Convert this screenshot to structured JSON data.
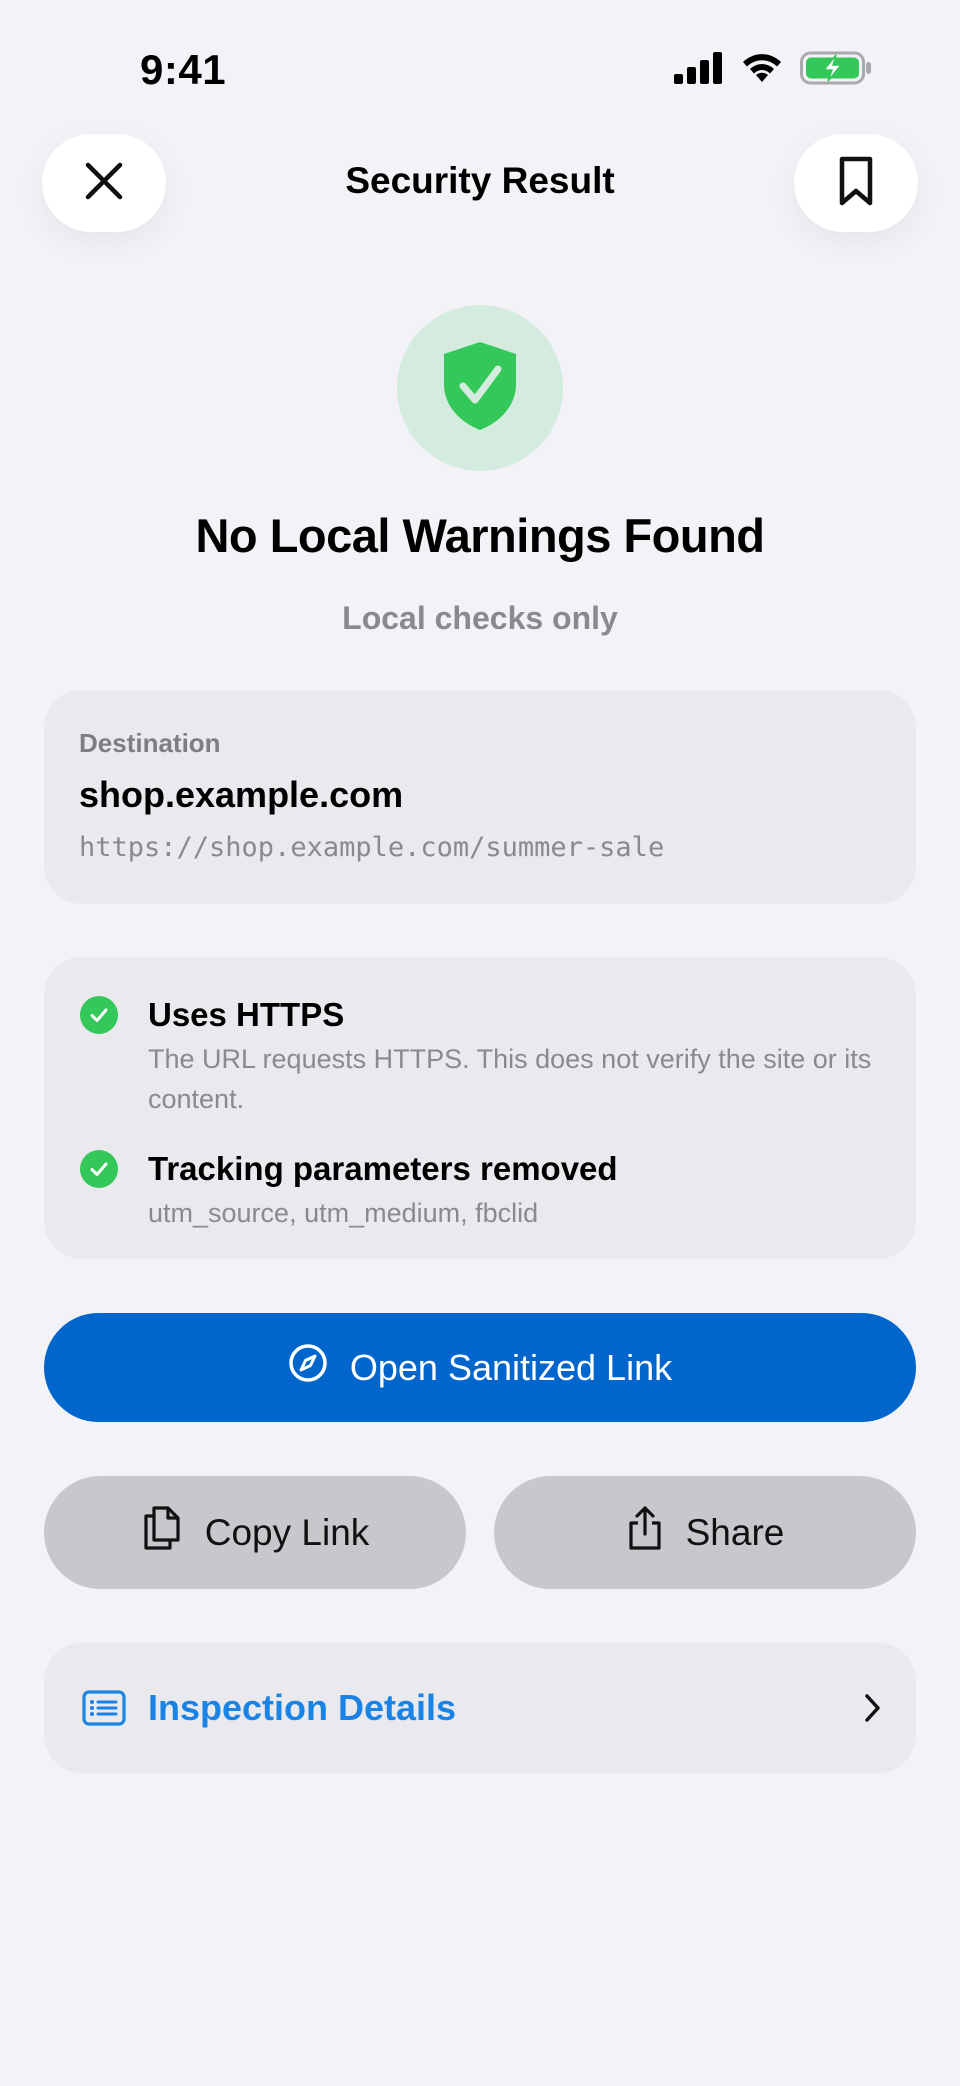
{
  "status_bar": {
    "time": "9:41",
    "icons": [
      "signal-icon",
      "wifi-icon",
      "battery-charging-icon"
    ]
  },
  "nav": {
    "title": "Security Result",
    "close_icon": "close-icon",
    "bookmark_icon": "bookmark-icon"
  },
  "hero": {
    "icon": "shield-check-icon",
    "title": "No Local Warnings Found",
    "subtitle": "Local checks only"
  },
  "destination": {
    "label": "Destination",
    "host": "shop.example.com",
    "url": "https://shop.example.com/summer-sale"
  },
  "checks": [
    {
      "title": "Uses HTTPS",
      "description": "The URL requests HTTPS. This does not verify the site or its content.",
      "icon": "checkmark-circle-icon"
    },
    {
      "title": "Tracking parameters removed",
      "description": "utm_source, utm_medium, fbclid",
      "icon": "checkmark-circle-icon"
    }
  ],
  "actions": {
    "open_label": "Open Sanitized Link",
    "open_icon": "compass-icon",
    "copy_label": "Copy Link",
    "copy_icon": "copy-icon",
    "share_label": "Share",
    "share_icon": "share-icon"
  },
  "inspection": {
    "label": "Inspection Details",
    "icon": "list-icon",
    "chevron": "chevron-right-icon"
  },
  "colors": {
    "accent": "#0066cc",
    "link": "#1a84e6",
    "success": "#34c759",
    "success_bg": "#d4ecdf",
    "background": "#f2f2f7",
    "card": "#e9e9ee",
    "secondary_button": "#c7c7cc"
  }
}
